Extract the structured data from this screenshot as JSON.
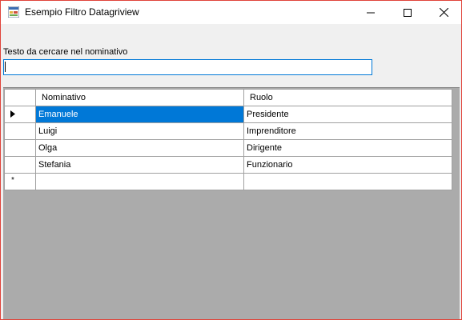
{
  "window": {
    "title": "Esempio Filtro Datagriview",
    "icon": "winforms-app-icon",
    "controls": {
      "minimize": "minimize-icon",
      "maximize": "maximize-icon",
      "close": "close-icon"
    }
  },
  "search": {
    "label": "Testo da cercare nel nominativo",
    "value": ""
  },
  "grid": {
    "columns": [
      "Nominativo",
      "Ruolo"
    ],
    "rows": [
      {
        "nominativo": "Emanuele",
        "ruolo": "Presidente",
        "current": true
      },
      {
        "nominativo": "Luigi",
        "ruolo": "Imprenditore"
      },
      {
        "nominativo": "Olga",
        "ruolo": "Dirigente"
      },
      {
        "nominativo": "Stefania",
        "ruolo": "Funzionario"
      }
    ],
    "new_row_marker": "*"
  },
  "colors": {
    "accent": "#0078d7",
    "window_border": "#e0443a",
    "grid_background": "#ababab"
  }
}
